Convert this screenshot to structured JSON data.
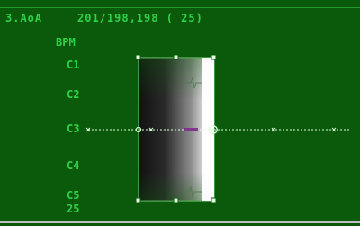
{
  "header": {
    "name": "3.AoA",
    "values": "201/198,198 ( 25)"
  },
  "axis": {
    "unit": "BPM",
    "ticks": [
      "C1",
      "C2",
      "C3",
      "C4",
      "C5",
      "25"
    ]
  },
  "colors": {
    "background": "#0b5a0b",
    "text": "#2fd04a",
    "accent": "#7b2a8a",
    "guide": "#d8ffd8"
  }
}
